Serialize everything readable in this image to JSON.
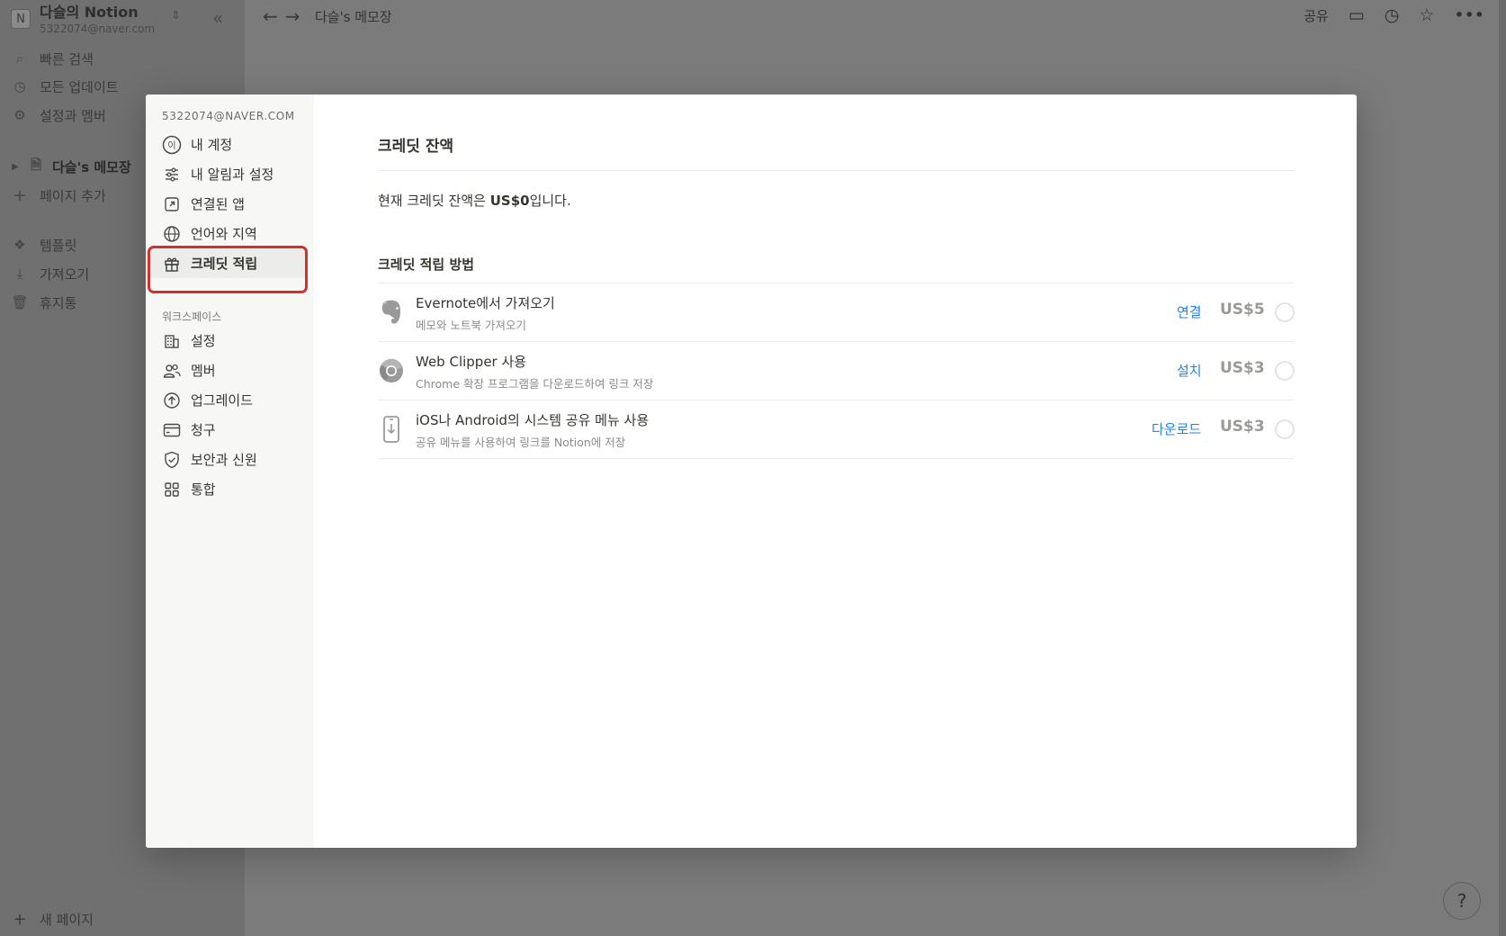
{
  "app": {
    "workspace_name": "다슬의 Notion",
    "workspace_email": "5322074@naver.com",
    "workspace_logo": "N"
  },
  "sidebar": {
    "items": [
      {
        "label": "빠른 검색",
        "icon": "search-icon"
      },
      {
        "label": "모든 업데이트",
        "icon": "clock-icon"
      },
      {
        "label": "설정과 멤버",
        "icon": "gear-icon"
      }
    ],
    "page": {
      "label": "다슬's 메모장",
      "icon": "page-icon"
    },
    "add_page": "페이지 추가",
    "extras": [
      {
        "label": "템플릿",
        "icon": "template-icon"
      },
      {
        "label": "가져오기",
        "icon": "import-icon"
      },
      {
        "label": "휴지통",
        "icon": "trash-icon"
      }
    ],
    "new_page": "새 페이지"
  },
  "topbar": {
    "breadcrumb": "다슬's 메모장",
    "share": "공유"
  },
  "modal": {
    "account_email": "5322074@NAVER.COM",
    "account_items": [
      {
        "label": "내 계정"
      },
      {
        "label": "내 알림과 설정"
      },
      {
        "label": "연결된 앱"
      },
      {
        "label": "언어와 지역"
      },
      {
        "label": "크레딧 적립"
      }
    ],
    "workspace_section": "워크스페이스",
    "workspace_items": [
      {
        "label": "설정"
      },
      {
        "label": "멤버"
      },
      {
        "label": "업그레이드"
      },
      {
        "label": "청구"
      },
      {
        "label": "보안과 신원"
      },
      {
        "label": "통합"
      }
    ],
    "content": {
      "title": "크레딧 잔액",
      "balance_prefix": "현재 크레딧 잔액은 ",
      "balance_amount": "US$0",
      "balance_suffix": "입니다.",
      "methods_title": "크레딧 적립 방법",
      "methods": [
        {
          "title": "Evernote에서 가져오기",
          "desc": "메모와 노트북 가져오기",
          "action": "연결",
          "reward": "US$5",
          "icon": "evernote-icon"
        },
        {
          "title": "Web Clipper 사용",
          "desc": "Chrome 확장 프로그램을 다운로드하여 링크 저장",
          "action": "설치",
          "reward": "US$3",
          "icon": "chrome-icon"
        },
        {
          "title": "iOS나 Android의 시스템 공유 메뉴 사용",
          "desc": "공유 메뉴를 사용하여 링크를 Notion에 저장",
          "action": "다운로드",
          "reward": "US$3",
          "icon": "mobile-download-icon"
        }
      ]
    }
  },
  "help": "?"
}
